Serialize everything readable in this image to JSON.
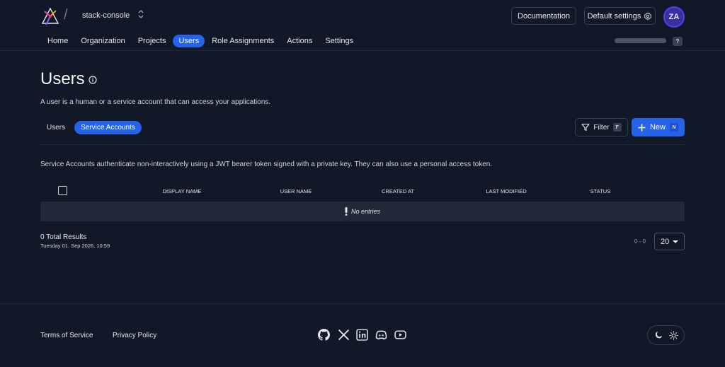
{
  "header": {
    "project_name": "stack-console",
    "documentation_label": "Documentation",
    "default_settings_label": "Default settings",
    "avatar_initials": "ZA",
    "help_label": "?"
  },
  "nav": {
    "items": [
      {
        "label": "Home",
        "active": false
      },
      {
        "label": "Organization",
        "active": false
      },
      {
        "label": "Projects",
        "active": false
      },
      {
        "label": "Users",
        "active": true
      },
      {
        "label": "Role Assignments",
        "active": false
      },
      {
        "label": "Actions",
        "active": false
      },
      {
        "label": "Settings",
        "active": false
      }
    ]
  },
  "page": {
    "title": "Users",
    "description": "A user is a human or a service account that can access your applications."
  },
  "subtabs": {
    "users_label": "Users",
    "service_accounts_label": "Service Accounts"
  },
  "toolbar": {
    "filter_label": "Filter",
    "filter_shortcut": "F",
    "new_label": "New",
    "new_shortcut": "N"
  },
  "service_accounts_description": "Service Accounts authenticate non-interactively using a JWT bearer token signed with a private key. They can also use a personal access token.",
  "table": {
    "columns": [
      "DISPLAY NAME",
      "USER NAME",
      "CREATED AT",
      "LAST MODIFIED",
      "STATUS"
    ],
    "empty_text": "No entries"
  },
  "pagination": {
    "total_results": "0 Total Results",
    "timestamp": "Tuesday 01. Sep 2026, 10:59",
    "range": "0 - 0",
    "page_size": "20"
  },
  "footer": {
    "terms_label": "Terms of Service",
    "privacy_label": "Privacy Policy",
    "social_icons": [
      "github-icon",
      "x-icon",
      "linkedin-icon",
      "discord-icon",
      "youtube-icon"
    ]
  },
  "colors": {
    "background": "#111827",
    "accent": "#2563eb",
    "row": "#1f2937",
    "avatar": "#3730a3"
  }
}
